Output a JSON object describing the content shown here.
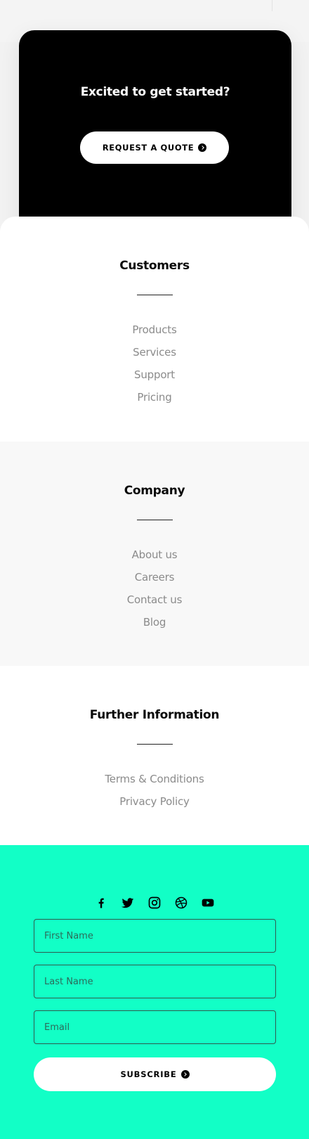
{
  "cta": {
    "title": "Excited to get started?",
    "button_label": "REQUEST A QUOTE"
  },
  "customers": {
    "heading": "Customers",
    "links": [
      "Products",
      "Services",
      "Support",
      "Pricing"
    ]
  },
  "company": {
    "heading": "Company",
    "links": [
      "About us",
      "Careers",
      "Contact us",
      "Blog"
    ]
  },
  "further": {
    "heading": "Further Information",
    "links": [
      "Terms & Conditions",
      "Privacy Policy"
    ]
  },
  "subscribe": {
    "social_icons": [
      "facebook-icon",
      "twitter-icon",
      "instagram-icon",
      "dribbble-icon",
      "youtube-icon"
    ],
    "first_name_placeholder": "First Name",
    "last_name_placeholder": "Last Name",
    "email_placeholder": "Email",
    "button_label": "SUBSCRIBE"
  },
  "colors": {
    "accent": "#12ffc6",
    "cta_background": "#000000",
    "link_text": "#8b8b8b"
  }
}
